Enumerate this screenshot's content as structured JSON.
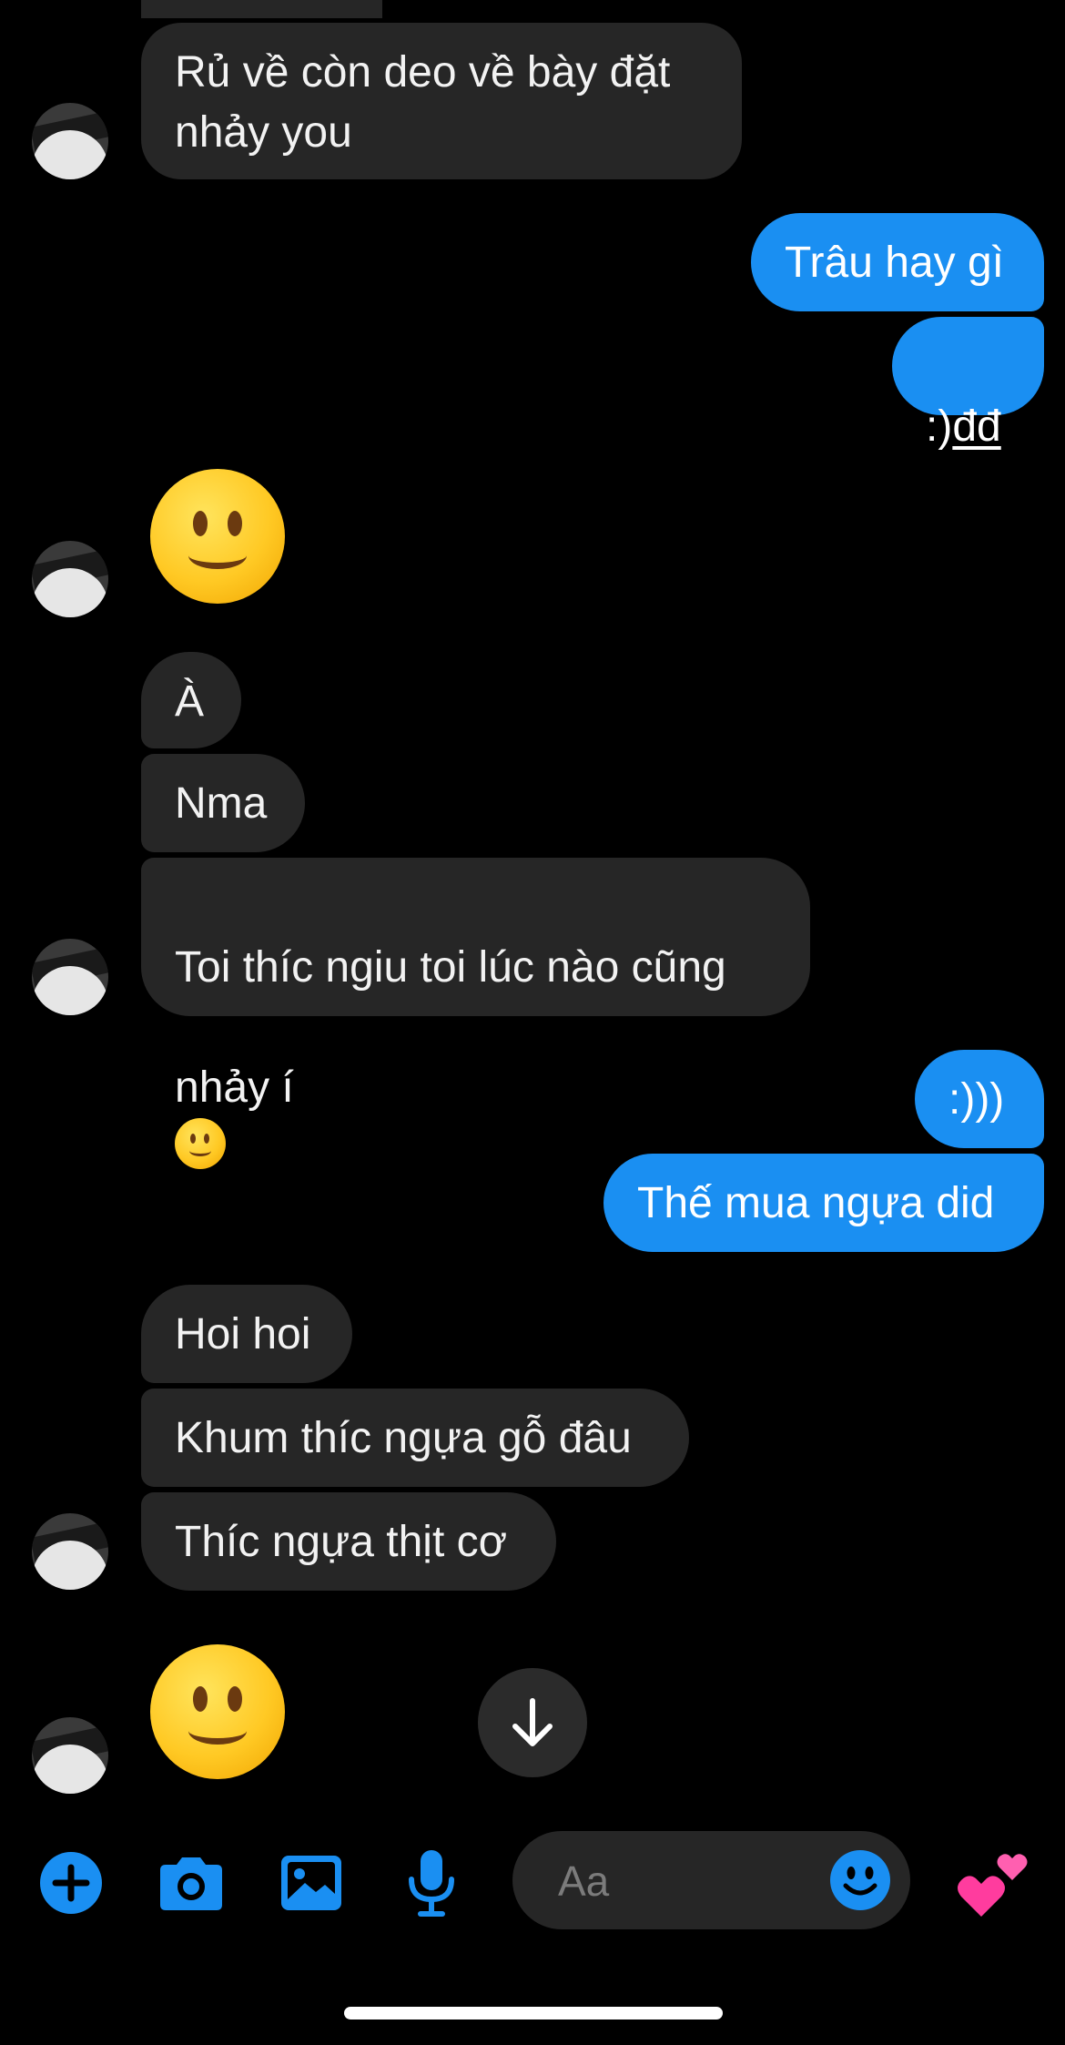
{
  "colors": {
    "background": "#000000",
    "incoming_bubble": "#262626",
    "outgoing_bubble": "#1a8ff2",
    "accent": "#1a8ff2"
  },
  "messages": [
    {
      "id": "m1",
      "side": "in",
      "text": "Rủ về còn deo về bày đặt\nnhảy you"
    },
    {
      "id": "m2",
      "side": "out",
      "text": "Trâu hay gì"
    },
    {
      "id": "m3",
      "side": "out",
      "prefix": ":)",
      "link": "đđ"
    },
    {
      "id": "m4",
      "side": "in",
      "emoji": "slightly-smiling-face"
    },
    {
      "id": "m5",
      "side": "in",
      "text": "À"
    },
    {
      "id": "m6",
      "side": "in",
      "text": "Nma"
    },
    {
      "id": "m7",
      "side": "in",
      "line1": "Toi thíc ngiu toi lúc nào cũng",
      "line2": "nhảy í",
      "emoji": "slightly-smiling-face"
    },
    {
      "id": "m8",
      "side": "out",
      "text": ":)))"
    },
    {
      "id": "m9",
      "side": "out",
      "text": "Thế mua ngựa did"
    },
    {
      "id": "m10",
      "side": "in",
      "text": "Hoi hoi"
    },
    {
      "id": "m11",
      "side": "in",
      "text": "Khum thíc ngựa gỗ đâu"
    },
    {
      "id": "m12",
      "side": "in",
      "text": "Thíc ngựa thịt cơ"
    },
    {
      "id": "m13",
      "side": "in",
      "emoji": "slightly-smiling-face"
    }
  ],
  "composer": {
    "placeholder": "Aa"
  },
  "toolbar": {
    "icons": [
      "plus-icon",
      "camera-icon",
      "image-icon",
      "microphone-icon",
      "emoji-icon",
      "two-hearts-icon"
    ]
  },
  "scroll_button": {
    "icon": "arrow-down-icon"
  }
}
